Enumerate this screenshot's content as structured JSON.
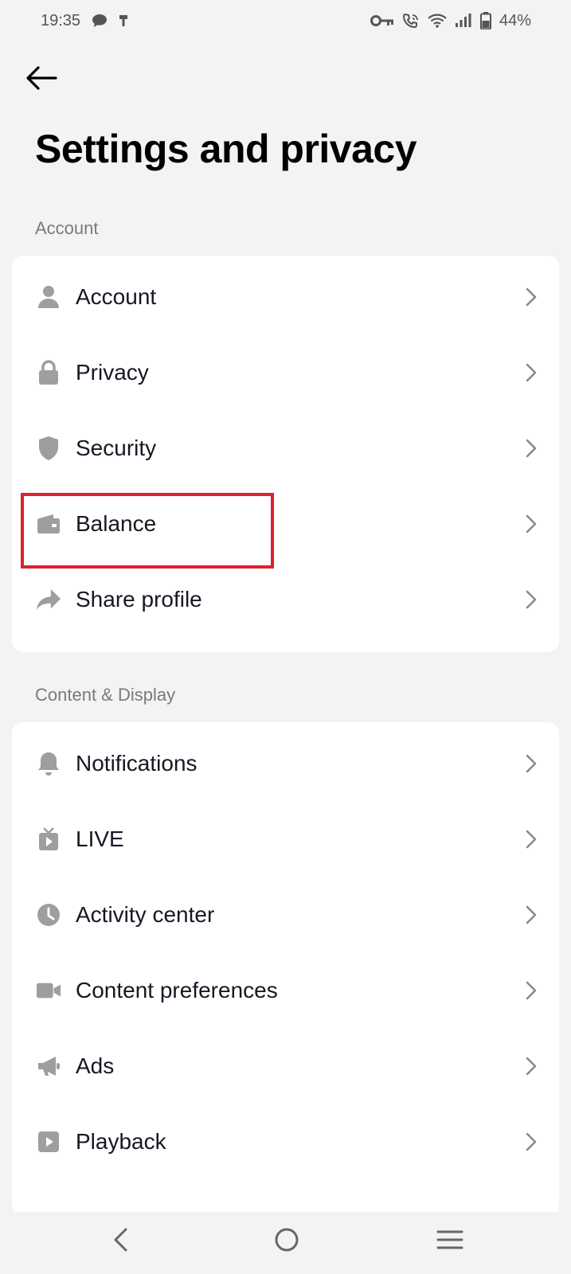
{
  "status_bar": {
    "time": "19:35",
    "battery": "44%",
    "icons": [
      "chat-bubble-icon",
      "usb-icon",
      "vpn-key-icon",
      "wifi-calling-icon",
      "wifi-icon",
      "signal-icon",
      "battery-icon"
    ]
  },
  "header": {
    "back_icon": "arrow-left-icon",
    "title": "Settings and privacy"
  },
  "sections": [
    {
      "label": "Account",
      "items": [
        {
          "label": "Account",
          "icon": "person-icon"
        },
        {
          "label": "Privacy",
          "icon": "lock-icon"
        },
        {
          "label": "Security",
          "icon": "shield-icon"
        },
        {
          "label": "Balance",
          "icon": "wallet-icon"
        },
        {
          "label": "Share profile",
          "icon": "share-arrow-icon"
        }
      ]
    },
    {
      "label": "Content & Display",
      "items": [
        {
          "label": "Notifications",
          "icon": "bell-icon"
        },
        {
          "label": "LIVE",
          "icon": "tv-icon"
        },
        {
          "label": "Activity center",
          "icon": "clock-icon"
        },
        {
          "label": "Content preferences",
          "icon": "video-camera-icon"
        },
        {
          "label": "Ads",
          "icon": "megaphone-icon"
        },
        {
          "label": "Playback",
          "icon": "play-icon"
        }
      ]
    }
  ],
  "nav_bar": {
    "icons": [
      "nav-back-icon",
      "home-icon",
      "recents-icon"
    ]
  },
  "colors": {
    "background": "#f3f3f3",
    "card": "#ffffff",
    "icon_gray": "#9e9e9e",
    "highlight": "#e0202c"
  }
}
